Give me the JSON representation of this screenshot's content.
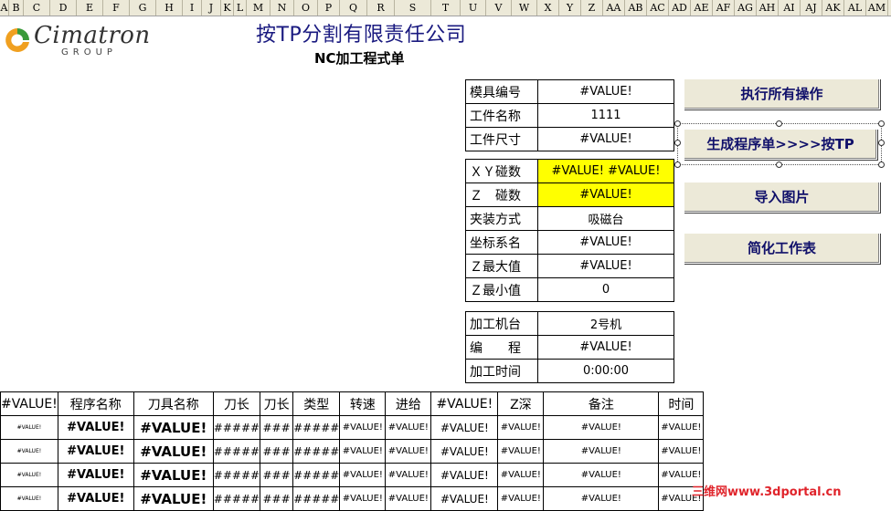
{
  "columns": [
    "A",
    "B",
    "C",
    "D",
    "E",
    "F",
    "G",
    "H",
    "I",
    "J",
    "K",
    "L",
    "M",
    "N",
    "O",
    "P",
    "Q",
    "R",
    "S",
    "T",
    "U",
    "V",
    "W",
    "X",
    "Y",
    "Z",
    "AA",
    "AB",
    "AC",
    "AD",
    "AE",
    "AF",
    "AG",
    "AH",
    "AI",
    "AJ",
    "AK",
    "AL",
    "AM"
  ],
  "logo": {
    "name": "Cimatron",
    "group": "GROUP",
    "icon": "cimatron-logo-icon"
  },
  "title": "按TP分割有限责任公司",
  "subtitle": "NC加工程式单",
  "info1": [
    {
      "label": "模具编号",
      "value": "#VALUE!"
    },
    {
      "label": "工件名称",
      "value": "1111"
    },
    {
      "label": "工件尺寸",
      "value": "#VALUE!"
    }
  ],
  "info2": [
    {
      "label": "ＸＹ碰数",
      "value": "#VALUE! #VALUE!",
      "highlight": true
    },
    {
      "label": "Ｚ　碰数",
      "value": "#VALUE!",
      "highlight": true
    },
    {
      "label": "夹装方式",
      "value": "吸磁台"
    },
    {
      "label": "坐标系名",
      "value": "#VALUE!"
    },
    {
      "label": "Ｚ最大值",
      "value": "#VALUE!"
    },
    {
      "label": "Ｚ最小值",
      "value": "0"
    }
  ],
  "info3": [
    {
      "label": "加工机台",
      "value": "2号机"
    },
    {
      "label": "编　　程",
      "value": "#VALUE!"
    },
    {
      "label": "加工时间",
      "value": "0:00:00"
    }
  ],
  "buttons": {
    "run_all": "执行所有操作",
    "gen_tp": "生成程序单>>>>按TP",
    "import_img": "导入图片",
    "simplify": "简化工作表"
  },
  "grid": {
    "headers": [
      "#VALUE!",
      "程序名称",
      "刀具名称",
      "刀长",
      "刀长",
      "类型",
      "转速",
      "进给",
      "#VALUE!",
      "Z深",
      "备注",
      "时间"
    ],
    "rows": [
      [
        "#VALUE!",
        "#VALUE!",
        "#VALUE!",
        "#####",
        "###",
        "#####",
        "#VALUE!",
        "#VALUE!",
        "#VALUE!",
        "#VALUE!",
        "#VALUE!",
        "#VALUE!"
      ],
      [
        "#VALUE!",
        "#VALUE!",
        "#VALUE!",
        "#####",
        "###",
        "#####",
        "#VALUE!",
        "#VALUE!",
        "#VALUE!",
        "#VALUE!",
        "#VALUE!",
        "#VALUE!"
      ],
      [
        "#VALUE!",
        "#VALUE!",
        "#VALUE!",
        "#####",
        "###",
        "#####",
        "#VALUE!",
        "#VALUE!",
        "#VALUE!",
        "#VALUE!",
        "#VALUE!",
        "#VALUE!"
      ],
      [
        "#VALUE!",
        "#VALUE!",
        "#VALUE!",
        "#####",
        "###",
        "#####",
        "#VALUE!",
        "#VALUE!",
        "#VALUE!",
        "#VALUE!",
        "#VALUE!",
        "#VALUE!"
      ]
    ]
  },
  "watermark": "三维网www.3dportal.cn",
  "colors": {
    "title": "#1a1a80",
    "highlight": "#ffff00",
    "button_bg": "#ece9d8",
    "watermark": "#e0242b"
  }
}
